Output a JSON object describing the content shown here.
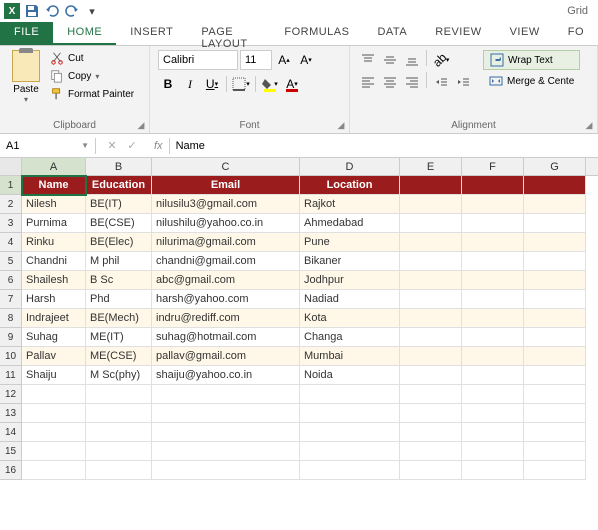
{
  "titlebar": {
    "right_text": "Grid"
  },
  "tabs": {
    "file": "FILE",
    "home": "HOME",
    "insert": "INSERT",
    "page_layout": "PAGE LAYOUT",
    "formulas": "FORMULAS",
    "data": "DATA",
    "review": "REVIEW",
    "view": "VIEW",
    "fo": "Fo"
  },
  "ribbon": {
    "clipboard": {
      "label": "Clipboard",
      "paste": "Paste",
      "cut": "Cut",
      "copy": "Copy",
      "format_painter": "Format Painter"
    },
    "font": {
      "label": "Font",
      "name": "Calibri",
      "size": "11"
    },
    "alignment": {
      "label": "Alignment",
      "wrap": "Wrap Text",
      "merge": "Merge & Cente"
    }
  },
  "namebox": "A1",
  "formula": "Name",
  "columns": [
    "A",
    "B",
    "C",
    "D",
    "E",
    "F",
    "G"
  ],
  "headers": {
    "name": "Name",
    "education": "Education",
    "email": "Email",
    "location": "Location"
  },
  "data_rows": [
    {
      "name": "Nilesh",
      "education": "BE(IT)",
      "email": "nilusilu3@gmail.com",
      "location": "Rajkot"
    },
    {
      "name": "Purnima",
      "education": "BE(CSE)",
      "email": "nilushilu@yahoo.co.in",
      "location": "Ahmedabad"
    },
    {
      "name": "Rinku",
      "education": "BE(Elec)",
      "email": "nilurima@gmail.com",
      "location": "Pune"
    },
    {
      "name": "Chandni",
      "education": "M phil",
      "email": "chandni@gmail.com",
      "location": "Bikaner"
    },
    {
      "name": "Shailesh",
      "education": "B Sc",
      "email": "abc@gmail.com",
      "location": "Jodhpur"
    },
    {
      "name": "Harsh",
      "education": "Phd",
      "email": "harsh@yahoo.com",
      "location": "Nadiad"
    },
    {
      "name": "Indrajeet",
      "education": "BE(Mech)",
      "email": "indru@rediff.com",
      "location": "Kota"
    },
    {
      "name": "Suhag",
      "education": "ME(IT)",
      "email": "suhag@hotmail.com",
      "location": "Changa"
    },
    {
      "name": "Pallav",
      "education": "ME(CSE)",
      "email": "pallav@gmail.com",
      "location": "Mumbai"
    },
    {
      "name": "Shaiju",
      "education": "M Sc(phy)",
      "email": "shaiju@yahoo.co.in",
      "location": "Noida"
    }
  ],
  "empty_rows": [
    12,
    13,
    14,
    15,
    16
  ],
  "chart_data": {
    "type": "table",
    "columns": [
      "Name",
      "Education",
      "Email",
      "Location"
    ],
    "rows": [
      [
        "Nilesh",
        "BE(IT)",
        "nilusilu3@gmail.com",
        "Rajkot"
      ],
      [
        "Purnima",
        "BE(CSE)",
        "nilushilu@yahoo.co.in",
        "Ahmedabad"
      ],
      [
        "Rinku",
        "BE(Elec)",
        "nilurima@gmail.com",
        "Pune"
      ],
      [
        "Chandni",
        "M phil",
        "chandni@gmail.com",
        "Bikaner"
      ],
      [
        "Shailesh",
        "B Sc",
        "abc@gmail.com",
        "Jodhpur"
      ],
      [
        "Harsh",
        "Phd",
        "harsh@yahoo.com",
        "Nadiad"
      ],
      [
        "Indrajeet",
        "BE(Mech)",
        "indru@rediff.com",
        "Kota"
      ],
      [
        "Suhag",
        "ME(IT)",
        "suhag@hotmail.com",
        "Changa"
      ],
      [
        "Pallav",
        "ME(CSE)",
        "pallav@gmail.com",
        "Mumbai"
      ],
      [
        "Shaiju",
        "M Sc(phy)",
        "shaiju@yahoo.co.in",
        "Noida"
      ]
    ]
  }
}
